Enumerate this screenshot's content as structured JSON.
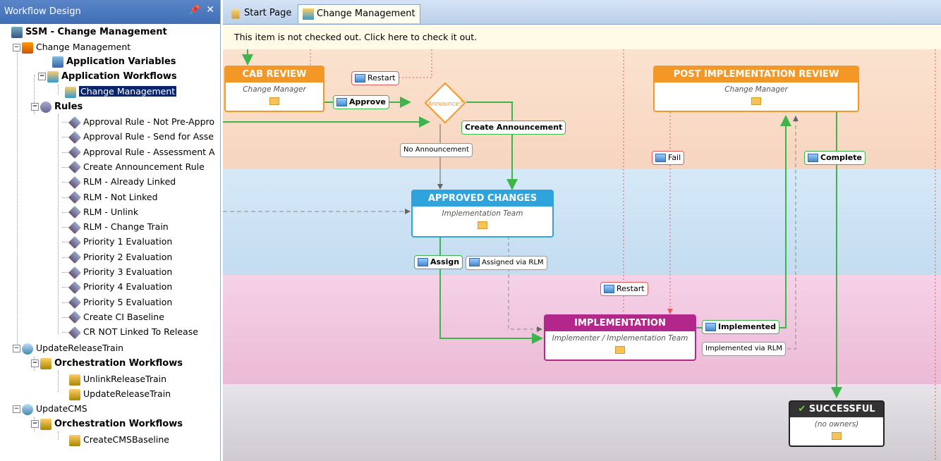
{
  "left_panel": {
    "title": "Workflow Design",
    "pin_icon": "pin-icon",
    "close_icon": "close-icon"
  },
  "tree": {
    "root": "SSM - Change Management",
    "change_management": "Change Management",
    "app_variables": "Application Variables",
    "app_workflows": "Application Workflows",
    "cm_workflow": "Change Management",
    "rules": "Rules",
    "rule_items": [
      "Approval Rule - Not Pre-Appro",
      "Approval Rule - Send for Asse",
      "Approval Rule - Assessment A",
      "Create Announcement Rule",
      "RLM - Already Linked",
      "RLM - Not Linked",
      "RLM - Unlink",
      "RLM - Change Train",
      "Priority 1 Evaluation",
      "Priority 2 Evaluation",
      "Priority 3 Evaluation",
      "Priority 4 Evaluation",
      "Priority 5 Evaluation",
      "Create CI Baseline",
      "CR NOT Linked To Release"
    ],
    "update_release_train": "UpdateReleaseTrain",
    "orch_workflows_1": "Orchestration Workflows",
    "unlink_release_train": "UnlinkReleaseTrain",
    "update_release_train_wf": "UpdateReleaseTrain",
    "update_cms": "UpdateCMS",
    "orch_workflows_2": "Orchestration Workflows",
    "create_cms_baseline": "CreateCMSBaseline"
  },
  "tabs": [
    "Start Page",
    "Change Management"
  ],
  "notice": "This item is not checked out.  Click here to check it out.",
  "nodes": {
    "cab_review": {
      "title": "CAB REVIEW",
      "owner": "Change Manager"
    },
    "post_impl": {
      "title": "POST IMPLEMENTATION REVIEW",
      "owner": "Change Manager"
    },
    "approved": {
      "title": "APPROVED CHANGES",
      "owner": "Implementation Team"
    },
    "implementation": {
      "title": "IMPLEMENTATION",
      "owner": "Implementer / Implementation Team"
    },
    "successful": {
      "title": "SUCCESSFUL",
      "owner": "(no owners)"
    },
    "decision": "Announce?"
  },
  "transitions": {
    "restart1": "Restart",
    "approve": "Approve",
    "create_announcement": "Create Announcement",
    "no_announcement": "No Announcement",
    "fail": "Fail",
    "complete": "Complete",
    "assign": "Assign",
    "assigned_via_rlm": "Assigned via RLM",
    "restart2": "Restart",
    "implemented": "Implemented",
    "implemented_via_rlm": "Implemented via RLM"
  },
  "colors": {
    "accent_orange": "#f39826",
    "accent_blue": "#2ea3dc",
    "accent_magenta": "#b3278c",
    "green": "#3cb54a",
    "red": "#e25a5a"
  }
}
